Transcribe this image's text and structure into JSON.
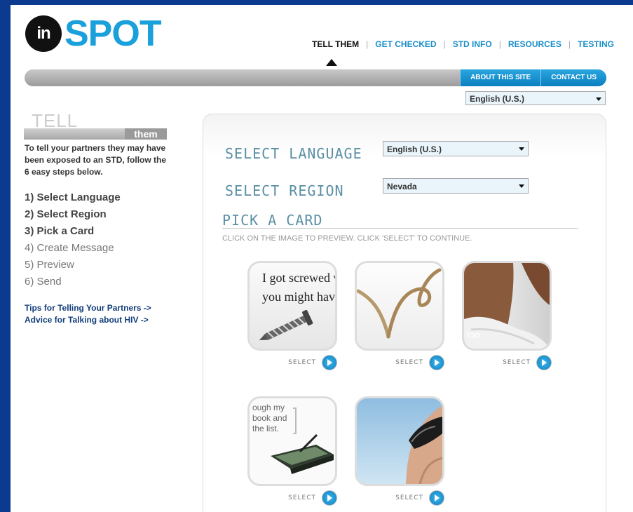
{
  "brand": {
    "logo_mark": "in",
    "logo_word": "SPOT"
  },
  "nav": {
    "items": [
      {
        "label": "TELL THEM",
        "active": true
      },
      {
        "label": "GET CHECKED",
        "active": false
      },
      {
        "label": "STD INFO",
        "active": false
      },
      {
        "label": "RESOURCES",
        "active": false
      },
      {
        "label": "TESTING",
        "active": false
      }
    ],
    "separator": "|"
  },
  "header_bar": {
    "about_label": "ABOUT THIS SITE",
    "contact_label": "CONTACT US"
  },
  "header_language": {
    "value": "English (U.S.)"
  },
  "sidebar": {
    "tell_word": "TELL",
    "them_tab": "them",
    "intro": "To tell your partners they may have been exposed to an STD, follow the 6 easy steps below.",
    "steps": [
      {
        "label": "1) Select Language",
        "done": true
      },
      {
        "label": "2) Select Region",
        "done": true
      },
      {
        "label": "3) Pick a Card",
        "done": true
      },
      {
        "label": "4) Create Message",
        "done": false
      },
      {
        "label": "5) Preview",
        "done": false
      },
      {
        "label": "6) Send",
        "done": false
      }
    ],
    "links": [
      "Tips for Telling Your Partners ->",
      "Advice for Talking about HIV ->"
    ]
  },
  "main": {
    "language_label": "SELECT LANGUAGE",
    "language_value": "English (U.S.)",
    "region_label": "SELECT REGION",
    "region_value": "Nevada",
    "pick_title": "PICK A CARD",
    "instructions": "CLICK ON THE IMAGE TO PREVIEW. CLICK 'SELECT' TO CONTINUE.",
    "select_label": "SELECT",
    "cards": [
      {
        "id": "screw",
        "text_lines": [
          "I got screwed whi",
          "you might have to"
        ]
      },
      {
        "id": "rope",
        "text_lines": []
      },
      {
        "id": "towel",
        "text_lines": [
          "ion."
        ]
      },
      {
        "id": "book",
        "text_lines": [
          "ough my",
          "book and",
          "the list."
        ]
      },
      {
        "id": "sunglasses",
        "text_lines": []
      }
    ]
  },
  "colors": {
    "brand_blue": "#1aa0db",
    "frame_blue": "#0b3a8f",
    "label_teal": "#5a8fa5",
    "link_navy": "#123e7a"
  }
}
